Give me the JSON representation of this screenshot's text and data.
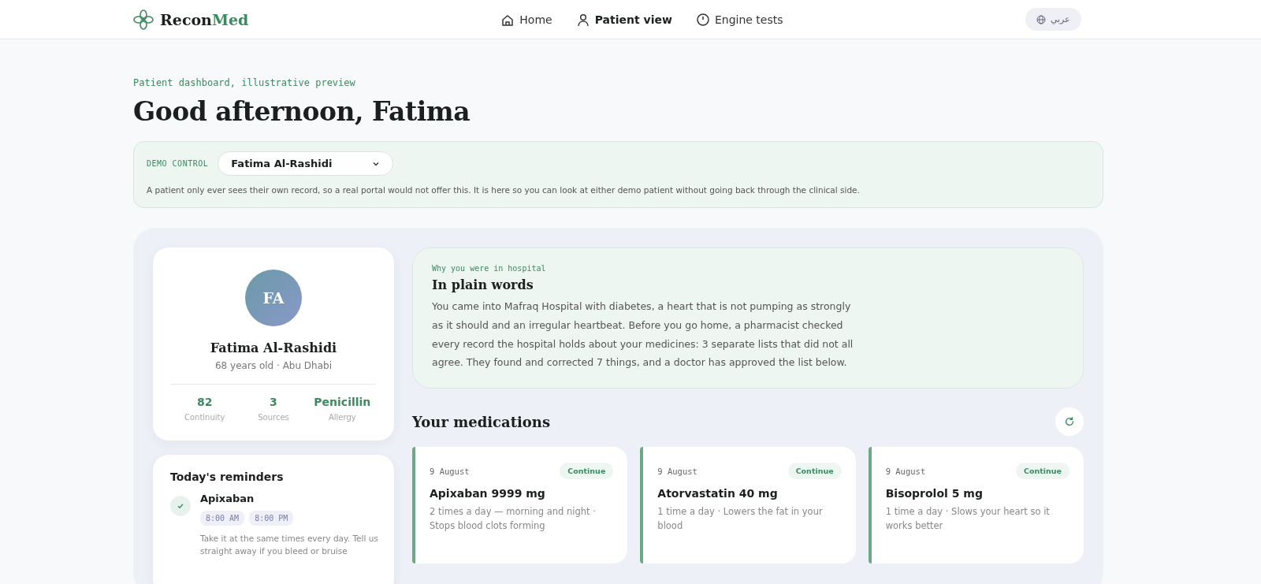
{
  "brand": {
    "name_part_1": "Recon",
    "name_part_2": "Med"
  },
  "nav": [
    {
      "label": "Home",
      "kind": "home",
      "selected": false
    },
    {
      "label": "Patient view",
      "kind": "person",
      "selected": true
    },
    {
      "label": "Engine tests",
      "kind": "clock",
      "selected": false
    }
  ],
  "language_button": "عربي",
  "eyebrow": "Patient dashboard, illustrative preview",
  "greeting": "Good afternoon, Fatima",
  "demo_control": {
    "label": "DEMO CONTROL",
    "patient_select": "Fatima Al-Rashidi",
    "note": "A patient only ever sees their own record, so a real portal would not offer this. It is here so you can look at either demo patient without going back through the clinical side."
  },
  "profile": {
    "initials": "FA",
    "name": "Fatima Al-Rashidi",
    "details": "68 years old · Abu Dhabi",
    "stats": [
      {
        "value": "82",
        "label": "Continuity"
      },
      {
        "value": "3",
        "label": "Sources"
      },
      {
        "value": "Penicillin",
        "label": "Allergy"
      }
    ]
  },
  "reminders": {
    "title": "Today's reminders",
    "items": [
      {
        "name": "Apixaban",
        "done": true,
        "times": [
          "8:00 AM",
          "8:00 PM"
        ],
        "note": "Take it at the same times every day. Tell us straight away if you bleed or bruise"
      }
    ]
  },
  "summary": {
    "eyebrow": "Why you were in hospital",
    "title": "In plain words",
    "text": "You came into Mafraq Hospital with diabetes, a heart that is not pumping as strongly as it should and an irregular heartbeat. Before you go home, a pharmacist checked every record the hospital holds about your medicines: 3 separate lists that did not all agree. They found and corrected 7 things, and a doctor has approved the list below."
  },
  "medications": {
    "title": "Your medications",
    "items": [
      {
        "date": "9 August",
        "status": "Continue",
        "name": "Apixaban 9999 mg",
        "description": "2 times a day — morning and night · Stops blood clots forming"
      },
      {
        "date": "9 August",
        "status": "Continue",
        "name": "Atorvastatin 40 mg",
        "description": "1 time a day · Lowers the fat in your blood"
      },
      {
        "date": "9 August",
        "status": "Continue",
        "name": "Bisoprolol 5 mg",
        "description": "1 time a day · Slows your heart so it works better"
      }
    ]
  }
}
